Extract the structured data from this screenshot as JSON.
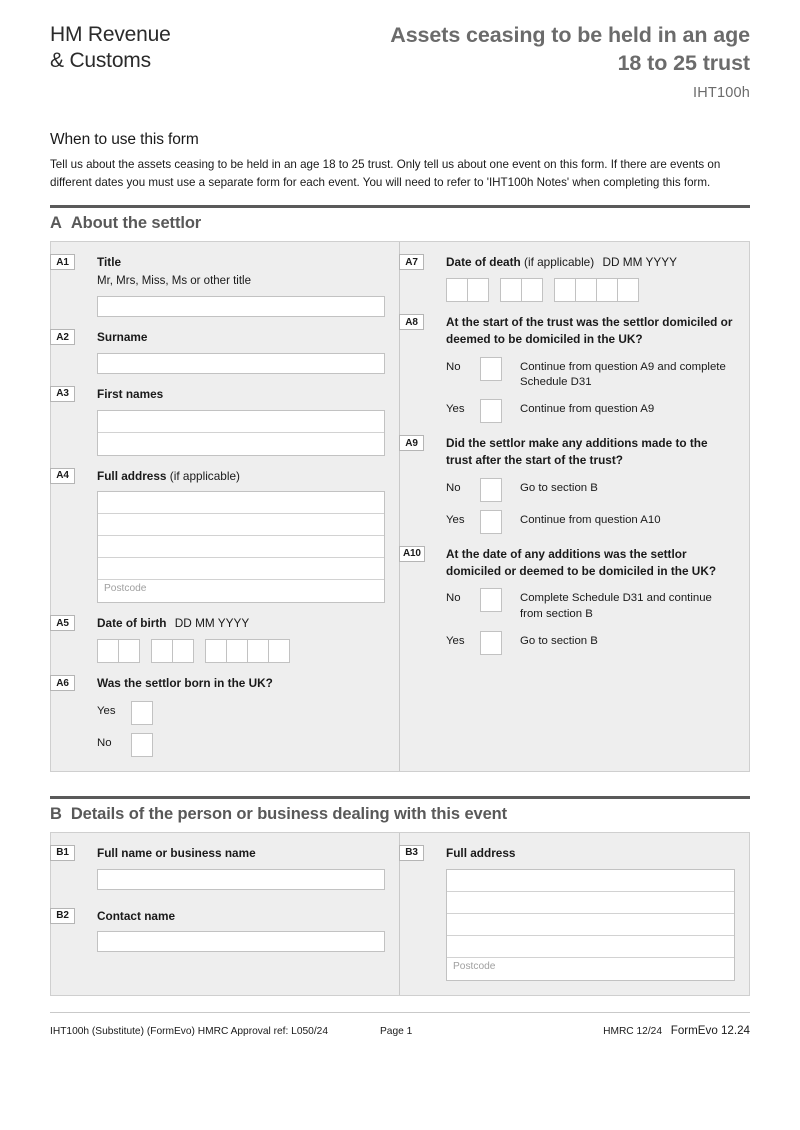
{
  "header": {
    "logo": "HM Revenue\n& Customs",
    "title": "Assets ceasing to be held in an age 18 to 25 trust",
    "form_code": "IHT100h"
  },
  "intro": {
    "heading": "When to use this form",
    "body": "Tell us about the assets ceasing to be held in an age 18 to 25 trust. Only tell us about one event on this form. If there are events on different dates you must use a separate form for each event. You will need to refer to 'IHT100h Notes' when completing this form."
  },
  "section_a": {
    "letter": "A",
    "title": "About the settlor",
    "a1": {
      "badge": "A1",
      "label": "Title",
      "hint": "Mr, Mrs, Miss, Ms or other title"
    },
    "a2": {
      "badge": "A2",
      "label": "Surname"
    },
    "a3": {
      "badge": "A3",
      "label": "First names"
    },
    "a4": {
      "badge": "A4",
      "label": "Full address",
      "label_light": "(if applicable)",
      "postcode_placeholder": "Postcode"
    },
    "a5": {
      "badge": "A5",
      "label": "Date of birth",
      "format": "DD MM YYYY"
    },
    "a6": {
      "badge": "A6",
      "label": "Was the settlor born in the UK?",
      "options": [
        {
          "label": "Yes",
          "text": ""
        },
        {
          "label": "No",
          "text": ""
        }
      ]
    },
    "a7": {
      "badge": "A7",
      "label": "Date of death",
      "label_light": "(if applicable)",
      "format": "DD MM YYYY"
    },
    "a8": {
      "badge": "A8",
      "label": "At the start of the trust was the settlor domiciled or deemed to be domiciled in the UK?",
      "options": [
        {
          "label": "No",
          "text": "Continue from question A9 and complete Schedule D31"
        },
        {
          "label": "Yes",
          "text": "Continue from question A9"
        }
      ]
    },
    "a9": {
      "badge": "A9",
      "label": "Did the settlor make any additions made to the trust after the start of the trust?",
      "options": [
        {
          "label": "No",
          "text": "Go to section B"
        },
        {
          "label": "Yes",
          "text": "Continue from question A10"
        }
      ]
    },
    "a10": {
      "badge": "A10",
      "label": "At the date of any additions was the settlor domiciled or deemed to be domiciled in the UK?",
      "options": [
        {
          "label": "No",
          "text": "Complete Schedule D31 and continue from section B"
        },
        {
          "label": "Yes",
          "text": "Go to section B"
        }
      ]
    }
  },
  "section_b": {
    "letter": "B",
    "title": "Details of the person or business dealing with this event",
    "b1": {
      "badge": "B1",
      "label": "Full name or business name"
    },
    "b2": {
      "badge": "B2",
      "label": "Contact name"
    },
    "b3": {
      "badge": "B3",
      "label": "Full address",
      "postcode_placeholder": "Postcode"
    }
  },
  "footer": {
    "approval": "IHT100h  (Substitute) (FormEvo) HMRC Approval ref: L050/24",
    "page": "Page 1",
    "hmrc_date": "HMRC 12/24",
    "formevo": "FormEvo 12.24"
  }
}
